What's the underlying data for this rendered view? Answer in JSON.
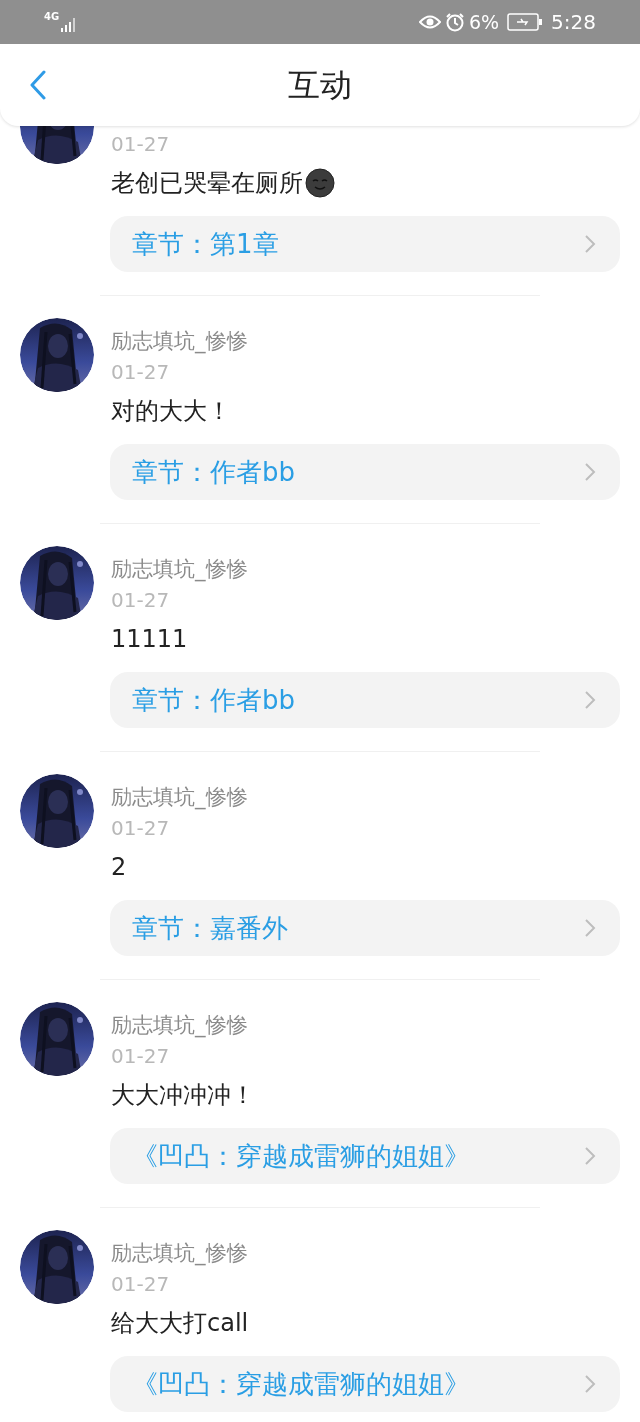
{
  "status_bar": {
    "network": "4G",
    "battery": "6%",
    "time": "5:28"
  },
  "header": {
    "title": "互动"
  },
  "comments": [
    {
      "date": "01-27",
      "text": "老创已哭晕在厕所",
      "trailing_emoji": true,
      "link": "章节：第1章"
    },
    {
      "name": "励志填坑_惨惨",
      "date": "01-27",
      "text": "对的大大！",
      "trailing_emoji": false,
      "link": "章节：作者bb"
    },
    {
      "name": "励志填坑_惨惨",
      "date": "01-27",
      "text": "11111",
      "trailing_emoji": false,
      "link": "章节：作者bb"
    },
    {
      "name": "励志填坑_惨惨",
      "date": "01-27",
      "text": "2",
      "trailing_emoji": false,
      "link": "章节：嘉番外"
    },
    {
      "name": "励志填坑_惨惨",
      "date": "01-27",
      "text": "大大冲冲冲！",
      "trailing_emoji": false,
      "link": "《凹凸：穿越成雷狮的姐姐》"
    },
    {
      "name": "励志填坑_惨惨",
      "date": "01-27",
      "text": "给大大打call",
      "trailing_emoji": false,
      "link": "《凹凸：穿越成雷狮的姐姐》"
    }
  ]
}
